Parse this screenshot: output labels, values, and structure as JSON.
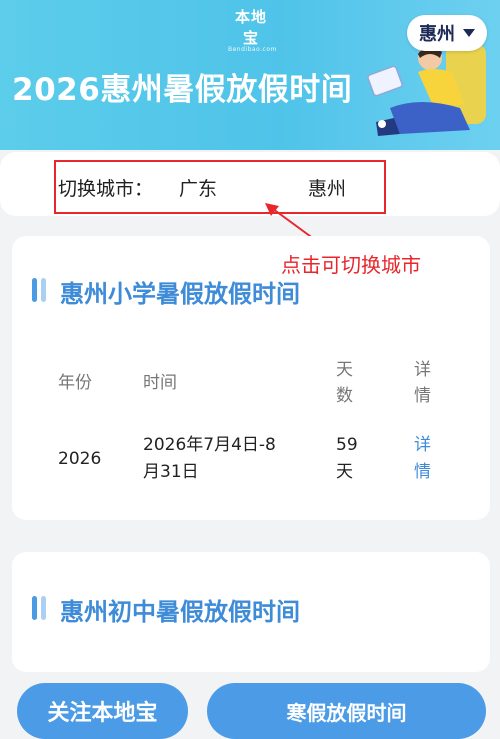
{
  "header": {
    "logo_cn": "本地宝",
    "logo_en": "Bendibao.com",
    "title": "2026惠州暑假放假时间",
    "city_selector": "惠州"
  },
  "switcher": {
    "label": "切换城市：",
    "province": "广东",
    "city": "惠州",
    "hint": "点击可切换城市"
  },
  "primary": {
    "section_title": "惠州小学暑假放假时间",
    "columns": {
      "year": "年份",
      "time": "时间",
      "days": "天\n数",
      "detail": "详\n情"
    },
    "row": {
      "year": "2026",
      "time": "2026年7月4日-8\n月31日",
      "days": "59\n天",
      "detail": "详\n情"
    }
  },
  "junior": {
    "section_title": "惠州初中暑假放假时间"
  },
  "bottom_bar": {
    "follow_label": "关注本地宝",
    "winter_label": "寒假放假时间"
  },
  "colors": {
    "banner": "#4fc3e9",
    "accent": "#3e8bd8",
    "highlight": "#e8262b",
    "button": "#4c9be6"
  }
}
